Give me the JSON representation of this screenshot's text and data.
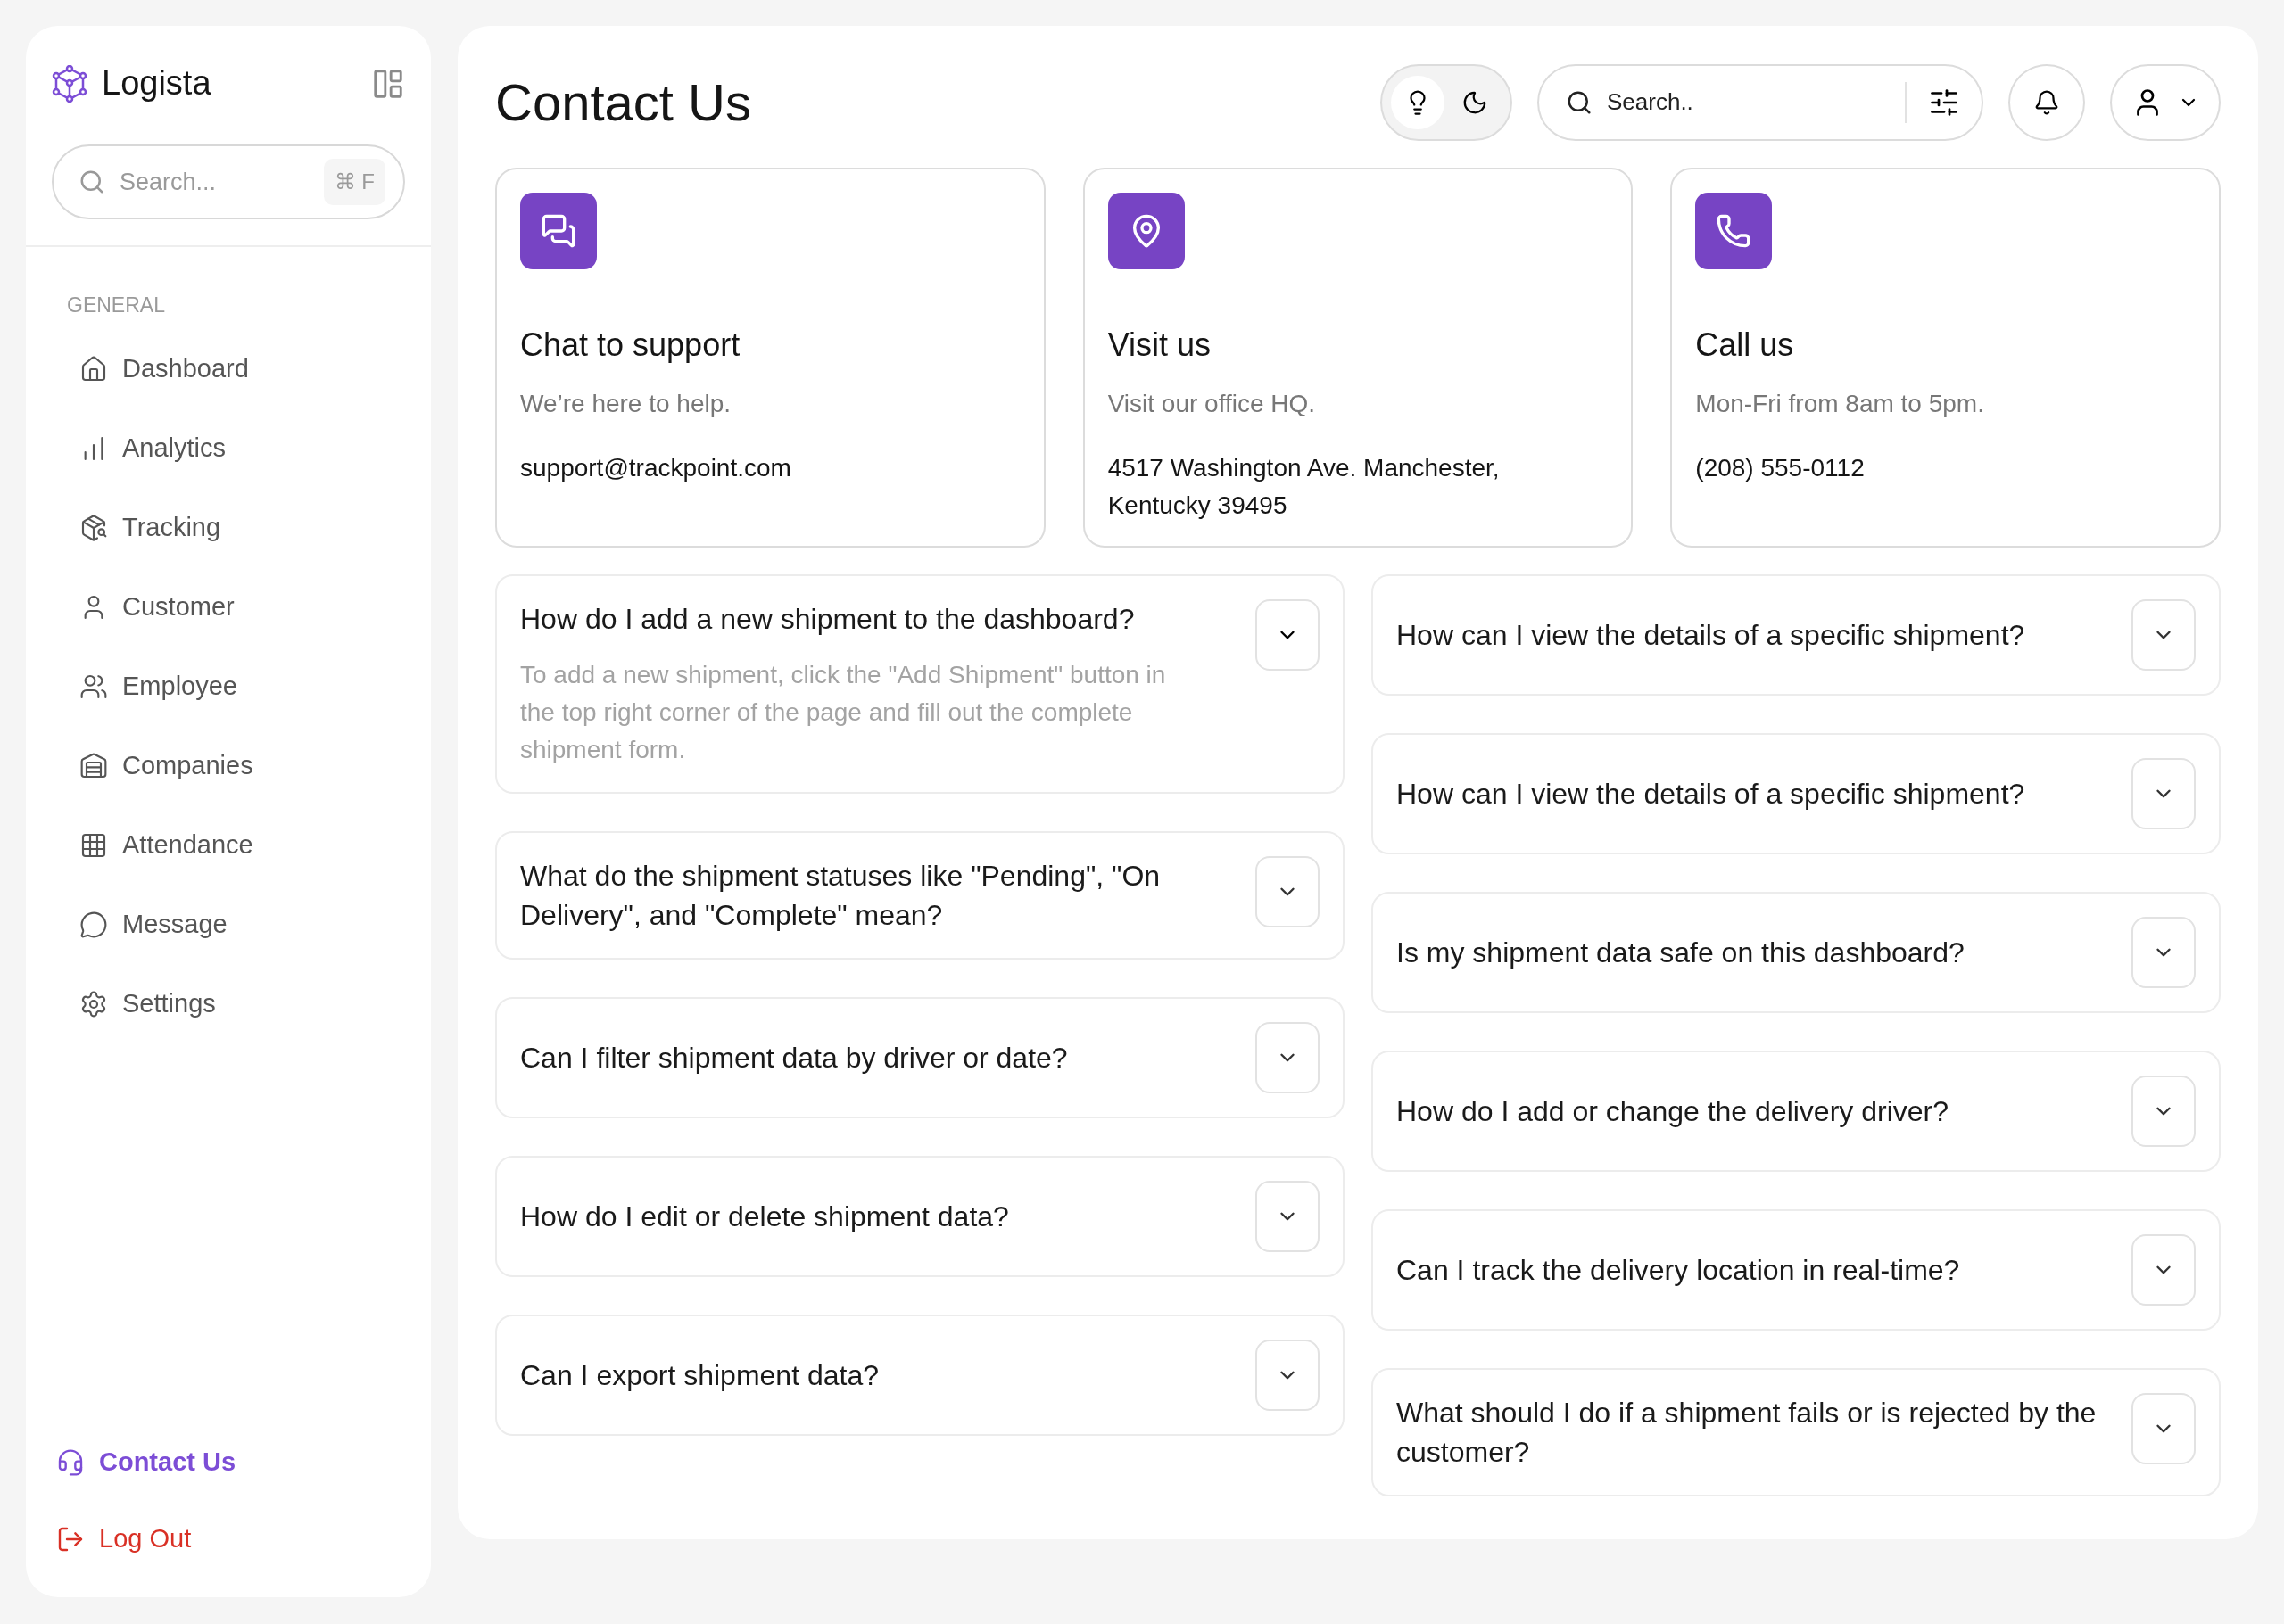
{
  "sidebar": {
    "brand": "Logista",
    "search": {
      "placeholder": "Search...",
      "shortcut": "⌘ F"
    },
    "section_label": "GENERAL",
    "items": [
      {
        "label": "Dashboard",
        "selected": false
      },
      {
        "label": "Analytics",
        "selected": false
      },
      {
        "label": "Tracking",
        "selected": false
      },
      {
        "label": "Customer",
        "selected": false
      },
      {
        "label": "Employee",
        "selected": false
      },
      {
        "label": "Companies",
        "selected": false
      },
      {
        "label": "Attendance",
        "selected": false
      },
      {
        "label": "Message",
        "selected": false
      },
      {
        "label": "Settings",
        "selected": false
      }
    ],
    "footer_items": [
      {
        "kind": "contact",
        "label": "Contact Us",
        "selected": true
      },
      {
        "kind": "logout",
        "label": "Log Out",
        "selected": false
      }
    ]
  },
  "header": {
    "title": "Contact Us",
    "theme_options": [
      {
        "kind": "light",
        "selected": true
      },
      {
        "kind": "dark",
        "selected": false
      }
    ],
    "search": {
      "placeholder": "Search.."
    }
  },
  "contact_cards": [
    {
      "kind": "chat",
      "title": "Chat to support",
      "subtitle": "We’re here to help.",
      "detail": "support@trackpoint.com"
    },
    {
      "kind": "visit",
      "title": "Visit us",
      "subtitle": "Visit our office HQ.",
      "detail": "4517 Washington Ave. Manchester, Kentucky 39495"
    },
    {
      "kind": "call",
      "title": "Call us",
      "subtitle": "Mon-Fri from 8am to 5pm.",
      "detail": "(208) 555-0112"
    }
  ],
  "faq_left": [
    {
      "question": "How do I add a new shipment to the dashboard?",
      "expanded": true,
      "answer": "To add a new shipment, click the \"Add Shipment\" button in the top right corner of the page and fill out the complete shipment form."
    },
    {
      "question": "What do the shipment statuses like \"Pending\", \"On Delivery\", and \"Complete\" mean?",
      "expanded": false
    },
    {
      "question": "Can I filter shipment data by driver or date?",
      "expanded": false
    },
    {
      "question": "How do I edit or delete shipment data?",
      "expanded": false
    },
    {
      "question": "Can I export shipment data?",
      "expanded": false
    }
  ],
  "faq_right": [
    {
      "question": "How can I view the details of a specific shipment?",
      "expanded": false
    },
    {
      "question": "How can I view the details of a specific shipment?",
      "expanded": false
    },
    {
      "question": "Is my shipment data safe on this dashboard?",
      "expanded": false
    },
    {
      "question": "How do I add or change the delivery driver?",
      "expanded": false
    },
    {
      "question": "Can I track the delivery location in real-time?",
      "expanded": false
    },
    {
      "question": "What should I do if a shipment fails or is rejected by the customer?",
      "expanded": false
    }
  ]
}
